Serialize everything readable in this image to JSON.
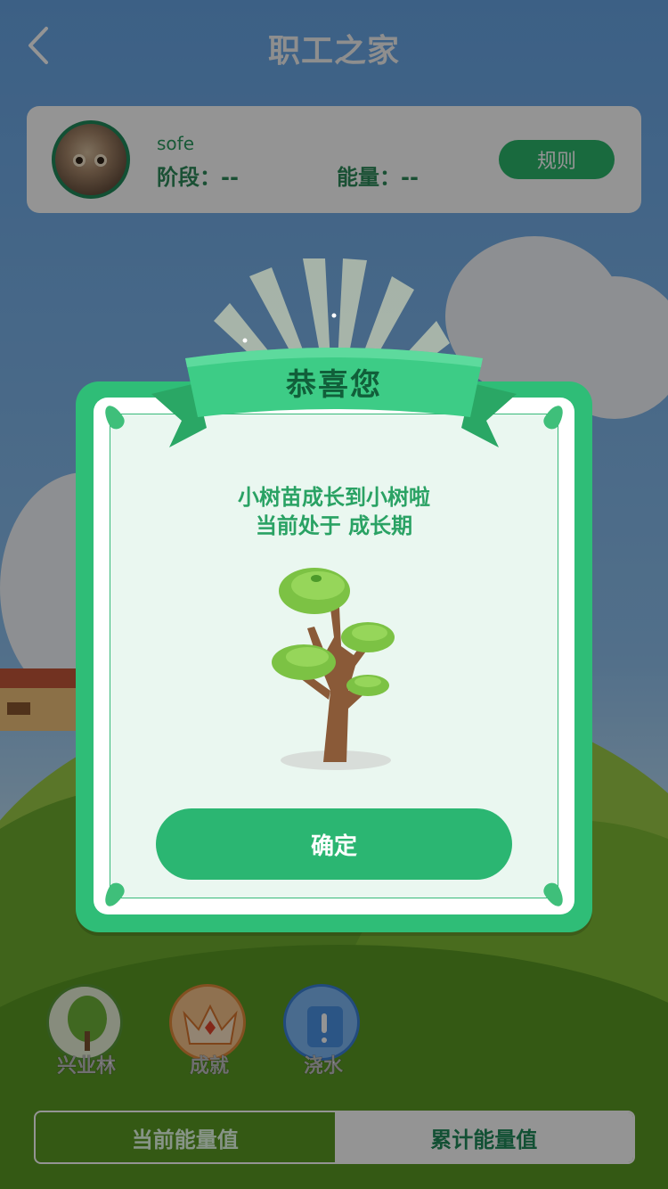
{
  "header": {
    "title": "职工之家",
    "back_icon": "chevron-left-icon"
  },
  "profile": {
    "username": "sofe",
    "stage_label": "阶段：--",
    "energy_label": "能量：--",
    "rules_button": "规则"
  },
  "actions": [
    {
      "label": "兴业林",
      "icon": "tree-icon"
    },
    {
      "label": "成就",
      "icon": "crown-icon"
    },
    {
      "label": "浇水",
      "icon": "watering-can-icon"
    }
  ],
  "tabs": {
    "current": "当前能量值",
    "total": "累计能量值"
  },
  "modal": {
    "title": "恭喜您",
    "message_line1": "小树苗成长到小树啦",
    "message_line2": "当前处于 成长期",
    "confirm_button": "确定"
  },
  "colors": {
    "brand_green": "#2bb672",
    "dark_green": "#1f8a5a",
    "title_green": "#115f3a"
  }
}
